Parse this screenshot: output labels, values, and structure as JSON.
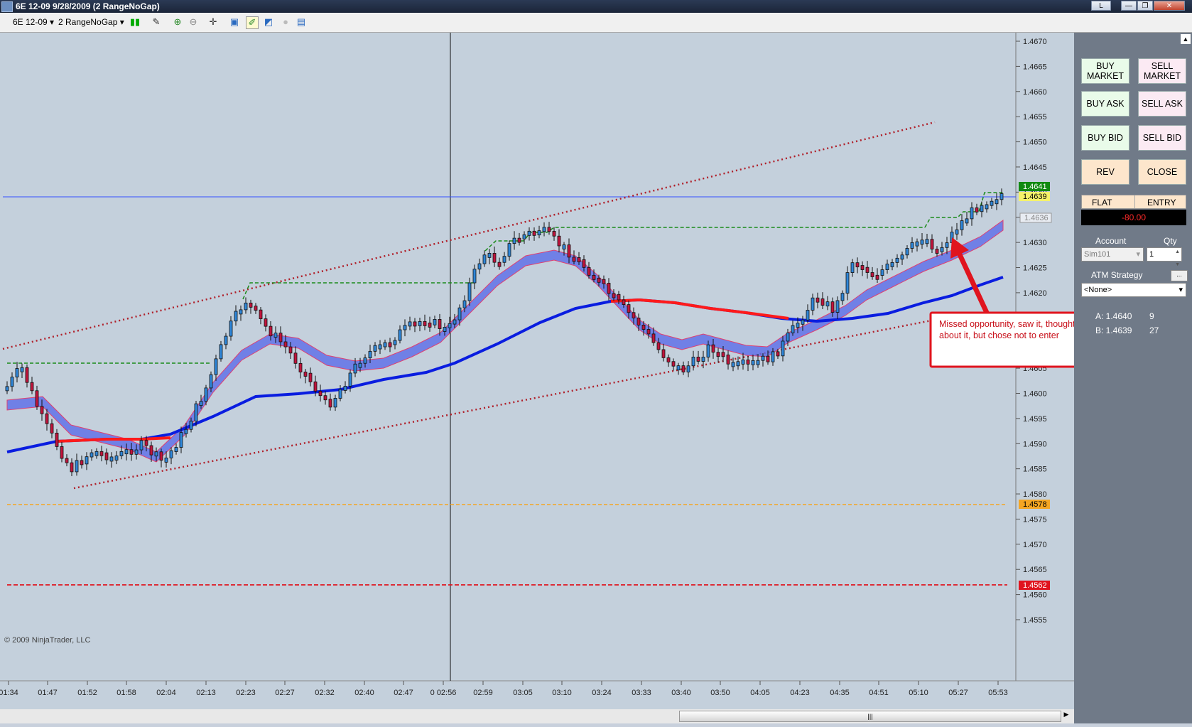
{
  "window": {
    "title": "6E 12-09  9/28/2009 (2 RangeNoGap)",
    "restore_label": "L",
    "minimize_label": "—",
    "maximize_label": "❐",
    "close_label": "✕"
  },
  "toolbar": {
    "instrument": "6E 12-09",
    "period": "2 RangeNoGap",
    "dropdown_arrow": "▾"
  },
  "chart": {
    "copyright": "© 2009 NinjaTrader, LLC",
    "annotation": "Missed opportunity, saw it, thought about it, but chose not to enter",
    "price_markers": [
      "1.4641",
      "1.4639",
      "1.4636",
      "1.4578",
      "1.4562"
    ],
    "colors": {
      "up_bar": "#2f86d8",
      "down_bar": "#c0143c",
      "background": "#c4d0dc",
      "sma_blue": "#0a1de0",
      "sma_red": "#ff1a1a"
    }
  },
  "chart_data": {
    "type": "candlestick",
    "y_tick_labels": [
      "1.4670",
      "1.4665",
      "1.4660",
      "1.4655",
      "1.4650",
      "1.4645",
      "1.4640",
      "1.4635",
      "1.4630",
      "1.4625",
      "1.4620",
      "1.4615",
      "1.4610",
      "1.4605",
      "1.4600",
      "1.4595",
      "1.4590",
      "1.4585",
      "1.4580",
      "1.4575",
      "1.4570",
      "1.4565",
      "1.4560",
      "1.4555"
    ],
    "x_tick_labels": [
      "01:34",
      "01:47",
      "01:52",
      "01:58",
      "02:04",
      "02:13",
      "02:23",
      "02:27",
      "02:32",
      "02:40",
      "02:47",
      "0 02:56",
      "02:59",
      "03:05",
      "03:10",
      "03:24",
      "03:33",
      "03:40",
      "03:50",
      "04:05",
      "04:23",
      "04:35",
      "04:51",
      "05:10",
      "05:27",
      "05:53"
    ],
    "ylim": [
      1.455,
      1.4673
    ],
    "horizontal_lines": [
      1.4639,
      1.4578,
      1.4562
    ]
  },
  "panel": {
    "buy_market": "BUY MARKET",
    "sell_market": "SELL MARKET",
    "buy_ask": "BUY ASK",
    "sell_ask": "SELL ASK",
    "buy_bid": "BUY BID",
    "sell_bid": "SELL BID",
    "rev": "REV",
    "close": "CLOSE",
    "flat": "FLAT",
    "entry": "ENTRY",
    "pnl": "-80.00",
    "account_label": "Account",
    "qty_label": "Qty",
    "account_value": "Sim101",
    "qty_value": "1",
    "atm_label": "ATM Strategy",
    "atm_value": "<None>",
    "ask_label": "A: 1.4640",
    "ask_size": "9",
    "bid_label": "B: 1.4639",
    "bid_size": "27"
  }
}
